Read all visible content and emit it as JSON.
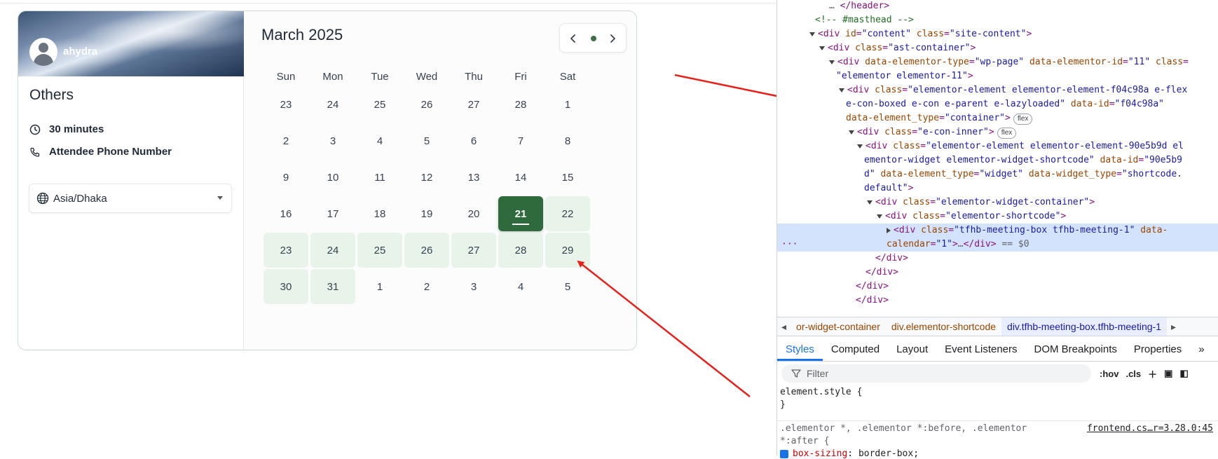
{
  "widget": {
    "username": "ahydra",
    "meeting_title": "Others",
    "duration": "30 minutes",
    "phone_label": "Attendee Phone Number",
    "timezone": "Asia/Dhaka",
    "month_label": "March 2025",
    "weekdays": [
      "Sun",
      "Mon",
      "Tue",
      "Wed",
      "Thu",
      "Fri",
      "Sat"
    ],
    "weeks": [
      [
        "23",
        "24",
        "25",
        "26",
        "27",
        "28",
        "1"
      ],
      [
        "2",
        "3",
        "4",
        "5",
        "6",
        "7",
        "8"
      ],
      [
        "9",
        "10",
        "11",
        "12",
        "13",
        "14",
        "15"
      ],
      [
        "16",
        "17",
        "18",
        "19",
        "20",
        "21",
        "22"
      ],
      [
        "23",
        "24",
        "25",
        "26",
        "27",
        "28",
        "29"
      ],
      [
        "30",
        "31",
        "1",
        "2",
        "3",
        "4",
        "5"
      ]
    ],
    "available_days": [
      "22",
      "23",
      "24",
      "25",
      "26",
      "27",
      "28",
      "29",
      "30",
      "31"
    ],
    "selected_day": "21",
    "accent_color": "#2e6a3b",
    "available_color": "#e8f3ea"
  },
  "devtools": {
    "dom_lines": [
      {
        "html": "<span class='dim'>…</span> &lt;/header&gt;"
      },
      {
        "html": "<span class='cm'>&lt;!-- #masthead --&gt;</span>"
      },
      {
        "html": "&lt;div <span class='an'>id</span>=<span class='av'>\"content\"</span> <span class='an'>class</span>=<span class='av'>\"site-content\"</span>&gt;"
      },
      {
        "html": "&lt;div <span class='an'>class</span>=<span class='av'>\"ast-container\"</span>&gt;"
      },
      {
        "html": "&lt;div <span class='an'>data-elementor-type</span>=<span class='av'>\"wp-page\"</span> <span class='an'>data-elementor-id</span>=<span class='av'>\"11\"</span> <span class='an'>class</span>="
      },
      {
        "html": "<span class='av'>\"elementor elementor-11\"</span>&gt;"
      },
      {
        "html": "&lt;div <span class='an'>class</span>=<span class='av'>\"elementor-element elementor-element-f04c98a e-flex</span>"
      },
      {
        "html": "<span class='av'>e-con-boxed e-con e-parent e-lazyloaded\"</span> <span class='an'>data-id</span>=<span class='av'>\"f04c98a\"</span>"
      },
      {
        "html": "<span class='an'>data-element_type</span>=<span class='av'>\"container\"</span>&gt;<span class='pill'>flex</span>"
      },
      {
        "html": "&lt;div <span class='an'>class</span>=<span class='av'>\"e-con-inner\"</span>&gt;<span class='pill'>flex</span>"
      },
      {
        "html": "&lt;div <span class='an'>class</span>=<span class='av'>\"elementor-element elementor-element-90e5b9d el</span>"
      },
      {
        "html": "<span class='av'>ementor-widget elementor-widget-shortcode\"</span> <span class='an'>data-id</span>=<span class='av'>\"90e5b9</span>"
      },
      {
        "html": "<span class='av'>d\"</span> <span class='an'>data-element_type</span>=<span class='av'>\"widget\"</span> <span class='an'>data-widget_type</span>=<span class='av'>\"shortcode.</span>"
      },
      {
        "html": "<span class='av'>default\"</span>&gt;"
      },
      {
        "html": "&lt;div <span class='an'>class</span>=<span class='av'>\"elementor-widget-container\"</span>&gt;"
      },
      {
        "html": "&lt;div <span class='an'>class</span>=<span class='av'>\"elementor-shortcode\"</span>&gt;"
      },
      {
        "html": "&lt;div <span class='an'>class</span>=<span class='av'>\"tfhb-meeting-box tfhb-meeting-1\"</span> <span class='an'>data-</span>"
      },
      {
        "html": "<span class='an'>calendar</span>=<span class='av'>\"1\"</span>&gt;<span class='dim'>…</span>&lt;/div&gt; <span class='dim'>== $0</span>"
      },
      {
        "html": "&lt;/div&gt;"
      },
      {
        "html": "&lt;/div&gt;"
      },
      {
        "html": "&lt;/div&gt;"
      },
      {
        "html": "&lt;/div&gt;"
      }
    ],
    "breadcrumbs": [
      "or-widget-container",
      "div.elementor-shortcode",
      "div.tfhb-meeting-box.tfhb-meeting-1"
    ],
    "tabs": [
      "Styles",
      "Computed",
      "Layout",
      "Event Listeners",
      "DOM Breakpoints",
      "Properties"
    ],
    "filter_placeholder": "Filter",
    "tool_hov": ":hov",
    "tool_cls": ".cls",
    "css_element_style": "element.style {",
    "css_close": "}",
    "css_selector_1": ".elementor *, .elementor *:before, .elementor",
    "css_selector_2": "*:after {",
    "css_source": "frontend.cs…r=3.28.0:45",
    "css_prop": "box-sizing",
    "css_val": "border-box;"
  }
}
